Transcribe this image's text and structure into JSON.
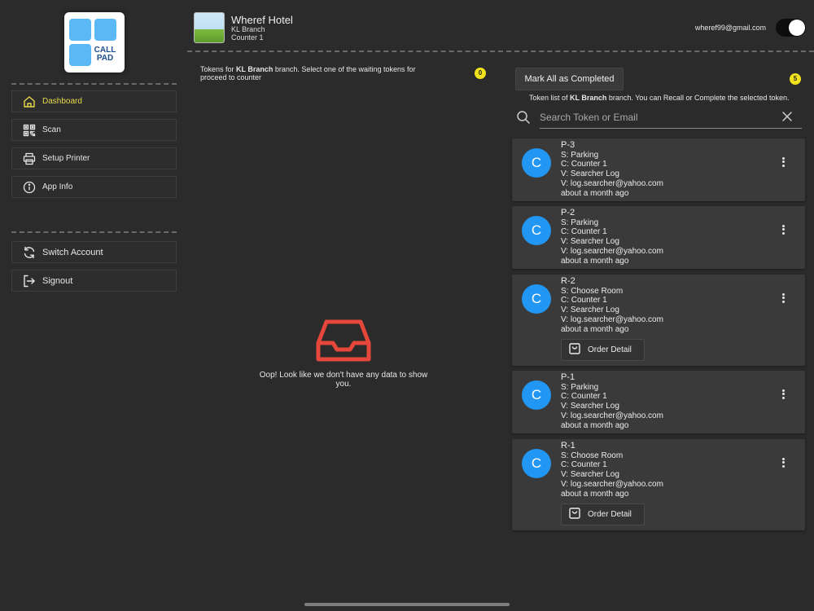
{
  "logo": {
    "text_line1": "CALL",
    "text_line2": "PAD"
  },
  "sidebar": {
    "items": [
      {
        "label": "Dashboard",
        "icon": "home-icon",
        "active": true
      },
      {
        "label": "Scan",
        "icon": "qr-code-icon"
      },
      {
        "label": "Setup Printer",
        "icon": "printer-icon"
      },
      {
        "label": "App Info",
        "icon": "info-icon"
      }
    ],
    "account_items": [
      {
        "label": "Switch Account",
        "icon": "refresh-icon"
      },
      {
        "label": "Signout",
        "icon": "signout-icon"
      }
    ]
  },
  "header": {
    "hotel_name": "Wheref Hotel",
    "branch": "KL Branch",
    "counter": "Counter 1",
    "email": "wheref99@gmail.com",
    "toggle_on": true
  },
  "waiting": {
    "info_prefix": "Tokens for ",
    "info_branch": "KL Branch",
    "info_suffix": " branch. Select one of the waiting tokens for proceed to counter",
    "count": "0",
    "empty_message": "Oop!  Look like we don't have any data to show you."
  },
  "token_list": {
    "mark_all_label": "Mark All as Completed",
    "count": "5",
    "info_prefix": "Token list of ",
    "info_branch": "KL Branch",
    "info_suffix": " branch. You can Recall or Complete the selected token.",
    "search_placeholder": "Search Token or Email",
    "cards": [
      {
        "avatar": "C",
        "token": "P-3",
        "service": "S: Parking",
        "counter": "C: Counter 1",
        "visitor": "V: Searcher Log",
        "email": "V: log.searcher@yahoo.com",
        "time": "about a month ago"
      },
      {
        "avatar": "C",
        "token": "P-2",
        "service": "S: Parking",
        "counter": "C: Counter 1",
        "visitor": "V: Searcher Log",
        "email": "V: log.searcher@yahoo.com",
        "time": "about a month ago"
      },
      {
        "avatar": "C",
        "token": "R-2",
        "service": "S: Choose Room",
        "counter": "C: Counter 1",
        "visitor": "V: Searcher Log",
        "email": "V: log.searcher@yahoo.com",
        "time": "about a month ago",
        "order_label": "Order Detail"
      },
      {
        "avatar": "C",
        "token": "P-1",
        "service": "S: Parking",
        "counter": "C: Counter 1",
        "visitor": "V: Searcher Log",
        "email": "V: log.searcher@yahoo.com",
        "time": "about a month ago"
      },
      {
        "avatar": "C",
        "token": "R-1",
        "service": "S: Choose Room",
        "counter": "C: Counter 1",
        "visitor": "V: Searcher Log",
        "email": "V: log.searcher@yahoo.com",
        "time": "about a month ago",
        "order_label": "Order Detail"
      }
    ]
  },
  "colors": {
    "accent_active": "#e8d94a",
    "avatar": "#2196f3",
    "badge": "#f2e21e",
    "empty_icon": "#e5473a"
  }
}
